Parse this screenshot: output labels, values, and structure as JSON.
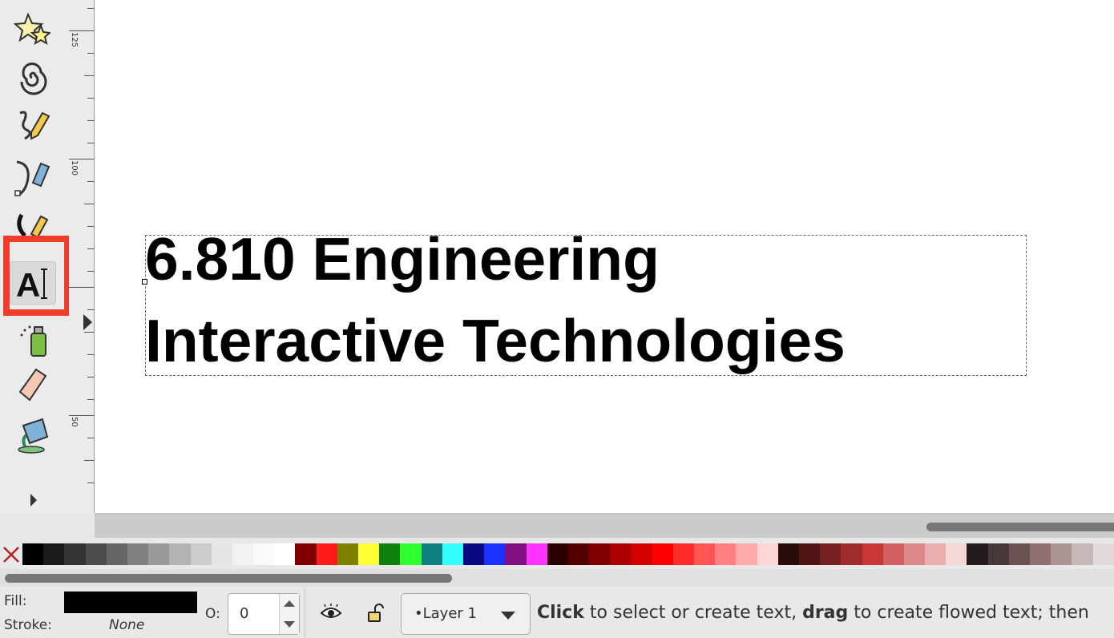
{
  "toolbox": {
    "tools": [
      {
        "name": "star-tool-icon"
      },
      {
        "name": "spiral-tool-icon"
      },
      {
        "name": "pencil-tool-icon"
      },
      {
        "name": "pen-tool-icon"
      },
      {
        "name": "calligraphy-tool-icon"
      },
      {
        "name": "text-tool-icon",
        "active": true
      },
      {
        "name": "spray-tool-icon"
      },
      {
        "name": "eraser-tool-icon"
      },
      {
        "name": "paint-bucket-tool-icon"
      }
    ],
    "highlight_color": "#f23c2a"
  },
  "ruler": {
    "labels": [
      "125",
      "100",
      "50"
    ]
  },
  "canvas": {
    "text_line_1": "6.810 Engineering",
    "text_line_2": "Interactive Technologies"
  },
  "palette": {
    "colors": [
      "#000000",
      "#1a1a1a",
      "#333333",
      "#4d4d4d",
      "#666666",
      "#808080",
      "#999999",
      "#b3b3b3",
      "#cccccc",
      "#e6e6e6",
      "#f2f2f2",
      "#f9f9f9",
      "#ffffff",
      "#800000",
      "#ff1a1a",
      "#808000",
      "#ffff33",
      "#0f7f0f",
      "#2eff2e",
      "#0f7f7f",
      "#33ffff",
      "#0a0a80",
      "#1a33ff",
      "#800f80",
      "#ff33ff",
      "#2b0000",
      "#550000",
      "#800000",
      "#aa0000",
      "#d40000",
      "#ff0000",
      "#ff2a2a",
      "#ff5555",
      "#ff8080",
      "#ffaaaa",
      "#ffd5d5",
      "#280b0b",
      "#501616",
      "#782121",
      "#a02c2c",
      "#c83737",
      "#d35f5f",
      "#de8787",
      "#e9afaf",
      "#f4d7d7",
      "#241c1c",
      "#483737",
      "#6c5353",
      "#917070",
      "#ac9393",
      "#c8b7b7",
      "#e3dbdb"
    ]
  },
  "statusbar": {
    "fill_label": "Fill:",
    "stroke_label": "Stroke:",
    "fill_color": "#000000",
    "stroke_value": "None",
    "opacity_label": "O:",
    "opacity_value": "0",
    "layer_name": "•Layer 1",
    "msg_b1": "Click",
    "msg_t1": " to select or create text, ",
    "msg_b2": "drag",
    "msg_t2": " to create flowed text; then"
  }
}
